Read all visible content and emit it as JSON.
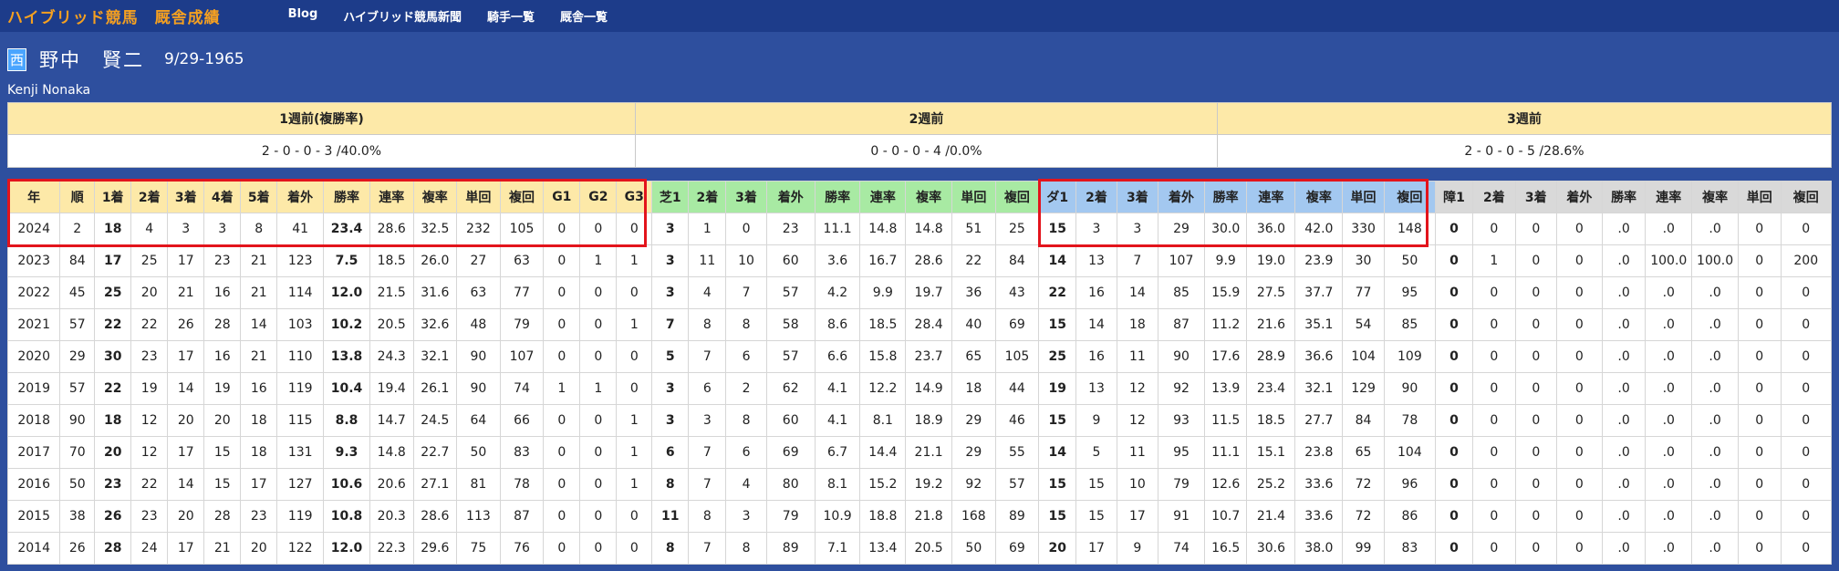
{
  "nav": {
    "brand": "ハイブリッド競馬",
    "brand_sub": "厩舎成績",
    "links": [
      "Blog",
      "ハイブリッド競馬新聞",
      "騎手一覧",
      "厩舎一覧"
    ]
  },
  "profile": {
    "affiliation_badge": "西",
    "name": "野中　賢二",
    "birth": "9/29-1965",
    "roman": "Kenji Nonaka"
  },
  "weeks": {
    "headers": [
      "1週前(複勝率)",
      "2週前",
      "3週前"
    ],
    "values": [
      "2 - 0 - 0 - 3 /40.0%",
      "0 - 0 - 0 - 4 /0.0%",
      "2 - 0 - 0 - 5 /28.6%"
    ]
  },
  "table": {
    "headers": [
      "年",
      "順",
      "1着",
      "2着",
      "3着",
      "4着",
      "5着",
      "着外",
      "勝率",
      "連率",
      "複率",
      "単回",
      "複回",
      "G1",
      "G2",
      "G3",
      "芝1",
      "2着",
      "3着",
      "着外",
      "勝率",
      "連率",
      "複率",
      "単回",
      "複回",
      "ダ1",
      "2着",
      "3着",
      "着外",
      "勝率",
      "連率",
      "複率",
      "単回",
      "複回",
      "障1",
      "2着",
      "3着",
      "着外",
      "勝率",
      "連率",
      "複率",
      "単回",
      "複回"
    ],
    "rows": [
      [
        "2024",
        "2",
        "18",
        "4",
        "3",
        "3",
        "8",
        "41",
        "23.4",
        "28.6",
        "32.5",
        "232",
        "105",
        "0",
        "0",
        "0",
        "3",
        "1",
        "0",
        "23",
        "11.1",
        "14.8",
        "14.8",
        "51",
        "25",
        "15",
        "3",
        "3",
        "29",
        "30.0",
        "36.0",
        "42.0",
        "330",
        "148",
        "0",
        "0",
        "0",
        "0",
        ".0",
        ".0",
        ".0",
        "0",
        "0"
      ],
      [
        "2023",
        "84",
        "17",
        "25",
        "17",
        "23",
        "21",
        "123",
        "7.5",
        "18.5",
        "26.0",
        "27",
        "63",
        "0",
        "1",
        "1",
        "3",
        "11",
        "10",
        "60",
        "3.6",
        "16.7",
        "28.6",
        "22",
        "84",
        "14",
        "13",
        "7",
        "107",
        "9.9",
        "19.0",
        "23.9",
        "30",
        "50",
        "0",
        "1",
        "0",
        "0",
        ".0",
        "100.0",
        "100.0",
        "0",
        "200"
      ],
      [
        "2022",
        "45",
        "25",
        "20",
        "21",
        "16",
        "21",
        "114",
        "12.0",
        "21.5",
        "31.6",
        "63",
        "77",
        "0",
        "0",
        "0",
        "3",
        "4",
        "7",
        "57",
        "4.2",
        "9.9",
        "19.7",
        "36",
        "43",
        "22",
        "16",
        "14",
        "85",
        "15.9",
        "27.5",
        "37.7",
        "77",
        "95",
        "0",
        "0",
        "0",
        "0",
        ".0",
        ".0",
        ".0",
        "0",
        "0"
      ],
      [
        "2021",
        "57",
        "22",
        "22",
        "26",
        "28",
        "14",
        "103",
        "10.2",
        "20.5",
        "32.6",
        "48",
        "79",
        "0",
        "0",
        "1",
        "7",
        "8",
        "8",
        "58",
        "8.6",
        "18.5",
        "28.4",
        "40",
        "69",
        "15",
        "14",
        "18",
        "87",
        "11.2",
        "21.6",
        "35.1",
        "54",
        "85",
        "0",
        "0",
        "0",
        "0",
        ".0",
        ".0",
        ".0",
        "0",
        "0"
      ],
      [
        "2020",
        "29",
        "30",
        "23",
        "17",
        "16",
        "21",
        "110",
        "13.8",
        "24.3",
        "32.1",
        "90",
        "107",
        "0",
        "0",
        "0",
        "5",
        "7",
        "6",
        "57",
        "6.6",
        "15.8",
        "23.7",
        "65",
        "105",
        "25",
        "16",
        "11",
        "90",
        "17.6",
        "28.9",
        "36.6",
        "104",
        "109",
        "0",
        "0",
        "0",
        "0",
        ".0",
        ".0",
        ".0",
        "0",
        "0"
      ],
      [
        "2019",
        "57",
        "22",
        "19",
        "14",
        "19",
        "16",
        "119",
        "10.4",
        "19.4",
        "26.1",
        "90",
        "74",
        "1",
        "1",
        "0",
        "3",
        "6",
        "2",
        "62",
        "4.1",
        "12.2",
        "14.9",
        "18",
        "44",
        "19",
        "13",
        "12",
        "92",
        "13.9",
        "23.4",
        "32.1",
        "129",
        "90",
        "0",
        "0",
        "0",
        "0",
        ".0",
        ".0",
        ".0",
        "0",
        "0"
      ],
      [
        "2018",
        "90",
        "18",
        "12",
        "20",
        "20",
        "18",
        "115",
        "8.8",
        "14.7",
        "24.5",
        "64",
        "66",
        "0",
        "0",
        "1",
        "3",
        "3",
        "8",
        "60",
        "4.1",
        "8.1",
        "18.9",
        "29",
        "46",
        "15",
        "9",
        "12",
        "93",
        "11.5",
        "18.5",
        "27.7",
        "84",
        "78",
        "0",
        "0",
        "0",
        "0",
        ".0",
        ".0",
        ".0",
        "0",
        "0"
      ],
      [
        "2017",
        "70",
        "20",
        "12",
        "17",
        "15",
        "18",
        "131",
        "9.3",
        "14.8",
        "22.7",
        "50",
        "83",
        "0",
        "0",
        "1",
        "6",
        "7",
        "6",
        "69",
        "6.7",
        "14.4",
        "21.1",
        "29",
        "55",
        "14",
        "5",
        "11",
        "95",
        "11.1",
        "15.1",
        "23.8",
        "65",
        "104",
        "0",
        "0",
        "0",
        "0",
        ".0",
        ".0",
        ".0",
        "0",
        "0"
      ],
      [
        "2016",
        "50",
        "23",
        "22",
        "14",
        "15",
        "17",
        "127",
        "10.6",
        "20.6",
        "27.1",
        "81",
        "78",
        "0",
        "0",
        "1",
        "8",
        "7",
        "4",
        "80",
        "8.1",
        "15.2",
        "19.2",
        "92",
        "57",
        "15",
        "15",
        "10",
        "79",
        "12.6",
        "25.2",
        "33.6",
        "72",
        "96",
        "0",
        "0",
        "0",
        "0",
        ".0",
        ".0",
        ".0",
        "0",
        "0"
      ],
      [
        "2015",
        "38",
        "26",
        "23",
        "20",
        "28",
        "23",
        "119",
        "10.8",
        "20.3",
        "28.6",
        "113",
        "87",
        "0",
        "0",
        "0",
        "11",
        "8",
        "3",
        "79",
        "10.9",
        "18.8",
        "21.8",
        "168",
        "89",
        "15",
        "15",
        "17",
        "91",
        "10.7",
        "21.4",
        "33.6",
        "72",
        "86",
        "0",
        "0",
        "0",
        "0",
        ".0",
        ".0",
        ".0",
        "0",
        "0"
      ],
      [
        "2014",
        "26",
        "28",
        "24",
        "17",
        "21",
        "20",
        "122",
        "12.0",
        "22.3",
        "29.6",
        "75",
        "76",
        "0",
        "0",
        "0",
        "8",
        "7",
        "8",
        "89",
        "7.1",
        "13.4",
        "20.5",
        "50",
        "69",
        "20",
        "17",
        "9",
        "74",
        "16.5",
        "30.6",
        "38.0",
        "99",
        "83",
        "0",
        "0",
        "0",
        "0",
        ".0",
        ".0",
        ".0",
        "0",
        "0"
      ]
    ]
  },
  "colors": {
    "page_bg": "#2e4f9e",
    "navbar_bg": "#1d3c8a",
    "brand": "#f5a020",
    "header_yellow": "#fde9a8",
    "header_green": "#a8eaa3",
    "header_blue": "#a3c8f0",
    "header_gray": "#d9d9d9",
    "highlight_red": "#e3141c"
  }
}
